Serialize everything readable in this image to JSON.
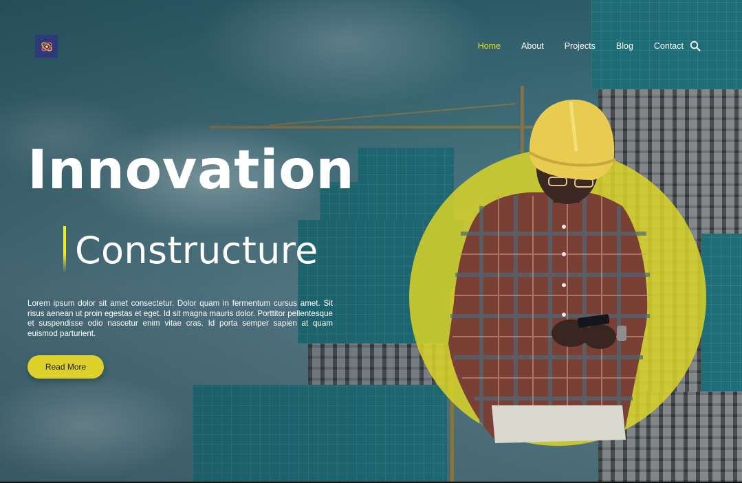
{
  "nav": {
    "items": [
      {
        "label": "Home",
        "active": true
      },
      {
        "label": "About",
        "active": false
      },
      {
        "label": "Projects",
        "active": false
      },
      {
        "label": "Blog",
        "active": false
      },
      {
        "label": "Contact",
        "active": false
      }
    ],
    "search_icon": "search-icon",
    "active_color": "#e8e025"
  },
  "logo": {
    "icon": "atom-logo-icon",
    "bg_color": "#2c3a78"
  },
  "hero": {
    "title": "Innovation",
    "subtitle": "Constructure",
    "accent_color": "#f2ec1a",
    "body": "Lorem ipsum dolor sit amet consectetur. Dolor quam in fermentum cursus amet. Sit risus aenean ut proin egestas et eget. Id sit magna mauris dolor. Porttitor pellentesque et suspendisse odio nascetur enim vitae cras. Id porta semper sapien at quam euismod parturient.",
    "cta_label": "Read More",
    "cta_color": "#ddd02b"
  }
}
